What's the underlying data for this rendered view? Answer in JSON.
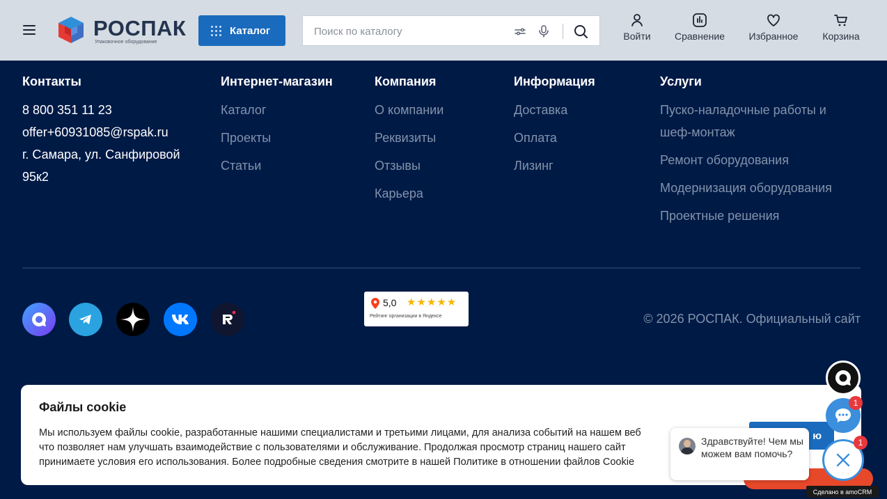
{
  "header": {
    "logo_text": "РОСПАК",
    "logo_subtitle": "Упаковочное оборудование",
    "catalog_label": "Каталог",
    "search_placeholder": "Поиск по каталогу",
    "actions": [
      {
        "label": "Войти",
        "icon": "user-icon"
      },
      {
        "label": "Сравнение",
        "icon": "compare-icon"
      },
      {
        "label": "Избранное",
        "icon": "heart-icon"
      },
      {
        "label": "Корзина",
        "icon": "cart-icon"
      }
    ]
  },
  "footer": {
    "contacts": {
      "title": "Контакты",
      "phone": "8 800 351 11 23",
      "email": "offer+60931085@rspak.ru",
      "address_line1": "г. Самара, ул. Санфировой",
      "address_line2": "95к2"
    },
    "shop": {
      "title": "Интернет-магазин",
      "links": [
        "Каталог",
        "Проекты",
        "Статьи"
      ]
    },
    "company": {
      "title": "Компания",
      "links": [
        "О компании",
        "Реквизиты",
        "Отзывы",
        "Карьера"
      ]
    },
    "info": {
      "title": "Информация",
      "links": [
        "Доставка",
        "Оплата",
        "Лизинг"
      ]
    },
    "services": {
      "title": "Услуги",
      "links": [
        "Пуско-наладочные работы и",
        "шеф-монтаж",
        "Ремонт оборудования",
        "Модернизация оборудования",
        "Проектные решения"
      ]
    },
    "socials": [
      "max-icon",
      "telegram-icon",
      "dzen-icon",
      "vk-icon",
      "rutube-icon"
    ],
    "yandex_rating": {
      "value": "5,0",
      "stars": "★★★★★",
      "caption": "Рейтинг организации в Яндексе"
    },
    "copyright": "© 2026 РОСПАК. Официальный сайт"
  },
  "cookie": {
    "title": "Файлы cookie",
    "line1": "Мы используем файлы cookie, разработанные нашими специалистами и третьими лицами, для анализа событий на нашем веб",
    "line2": "что позволяет нам улучшать взаимодействие с пользователями и обслуживание. Продолжая просмотр страниц нашего сайт",
    "line3": "принимаете условия его использования. Более подробные сведения смотрите в нашей Политике в отношении файлов Cookie",
    "accept_label": "ю"
  },
  "chat": {
    "message": "Здравствуйте! Чем мы можем вам помочь?",
    "badge_count_1": "1",
    "badge_count_2": "1",
    "amo_label": "Сделано в amoCRM"
  },
  "colors": {
    "footer_bg": "#001a46",
    "header_bg": "#d6dce3",
    "accent": "#1a6bbd",
    "link_muted": "#8393ab"
  }
}
